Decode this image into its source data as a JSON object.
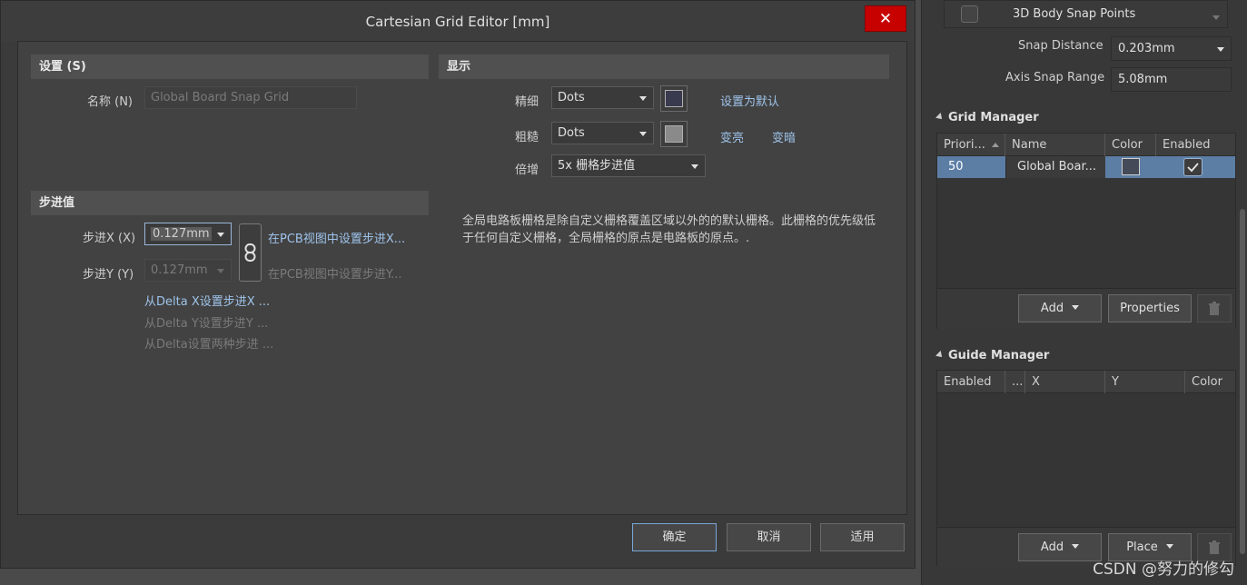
{
  "dialog": {
    "title": "Cartesian Grid Editor [mm]",
    "close": "✕",
    "settings": {
      "header": "设置 (S)",
      "name_label": "名称 (N)",
      "name_value": "Global Board Snap Grid"
    },
    "display": {
      "header": "显示",
      "fine_label": "精细",
      "fine_value": "Dots",
      "fine_color": "#3a3a4e",
      "coarse_label": "粗糙",
      "coarse_value": "Dots",
      "coarse_color": "#8a8a8a",
      "multiplier_label": "倍增",
      "multiplier_value": "5x 栅格步进值",
      "set_default": "设置为默认",
      "lighter": "变亮",
      "darker": "变暗",
      "description": "全局电路板栅格是除自定义栅格覆盖区域以外的的默认栅格。此栅格的优先级低于任何自定义栅格，全局栅格的原点是电路板的原点。."
    },
    "step": {
      "header": "步进值",
      "x_label": "步进X (X)",
      "x_value": "0.127mm",
      "y_label": "步进Y (Y)",
      "y_value": "0.127mm",
      "set_x_in_pcb": "在PCB视图中设置步进X...",
      "set_y_in_pcb": "在PCB视图中设置步进Y...",
      "from_delta_x": "从Delta X设置步进X ...",
      "from_delta_y": "从Delta Y设置步进Y ...",
      "from_delta_both": "从Delta设置两种步进 ..."
    },
    "buttons": {
      "ok": "确定",
      "cancel": "取消",
      "apply": "适用"
    }
  },
  "panel": {
    "snap_points_label": "3D Body Snap Points",
    "snap_distance_label": "Snap Distance",
    "snap_distance_value": "0.203mm",
    "axis_snap_label": "Axis Snap Range",
    "axis_snap_value": "5.08mm",
    "grid_manager": {
      "title": "Grid Manager",
      "columns": [
        "Priori...",
        "Name",
        "Color",
        "Enabled"
      ],
      "rows": [
        {
          "priority": "50",
          "name": "Global Boar...",
          "color": "#444a57",
          "enabled": true
        }
      ],
      "add": "Add",
      "properties": "Properties"
    },
    "guide_manager": {
      "title": "Guide Manager",
      "columns": [
        "Enabled",
        "...",
        "X",
        "Y",
        "Color"
      ],
      "add": "Add",
      "place": "Place"
    }
  },
  "watermark": "CSDN @努力的修勾"
}
